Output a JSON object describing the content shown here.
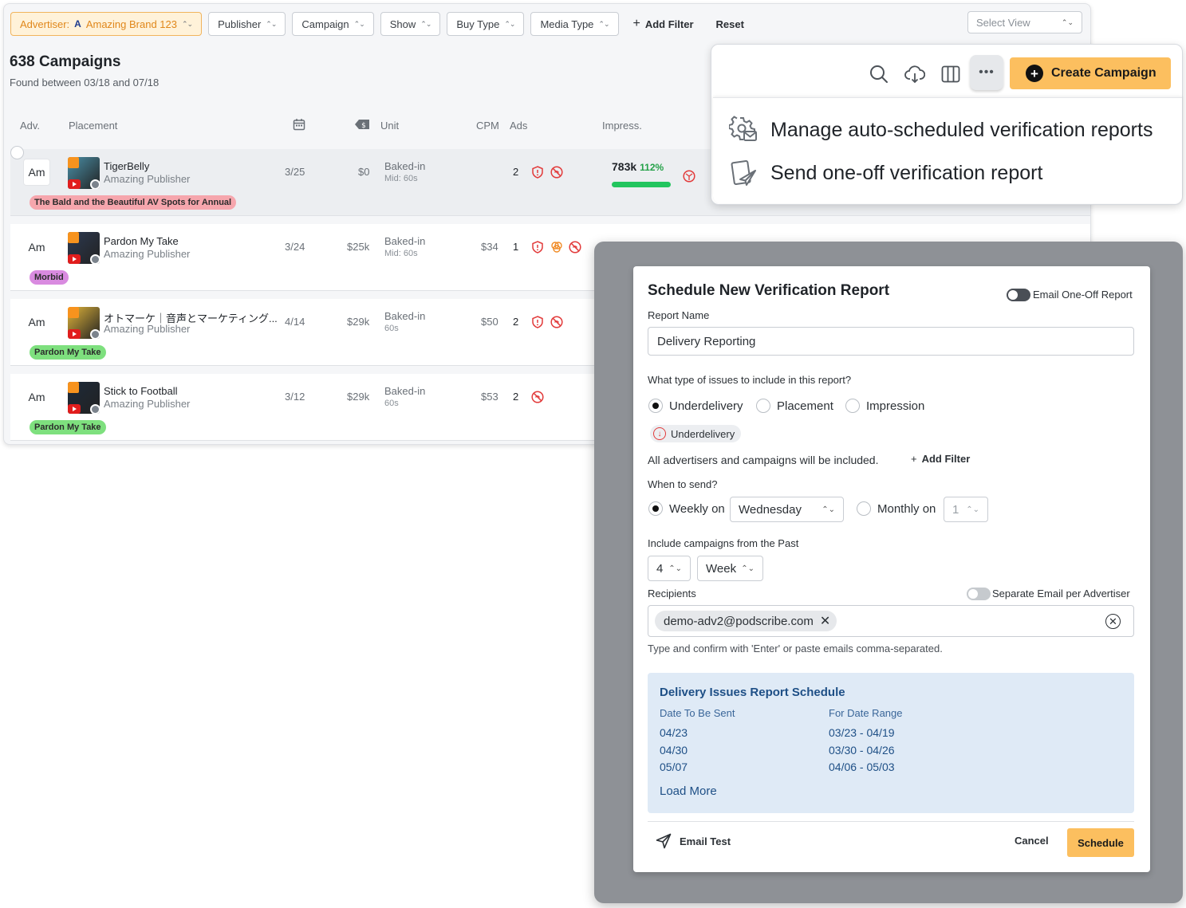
{
  "filters": {
    "advertiser_label": "Advertiser:",
    "advertiser_mark": "A",
    "advertiser_value": "Amazing Brand 123",
    "publisher": "Publisher",
    "campaign": "Campaign",
    "show": "Show",
    "buy_type": "Buy Type",
    "media_type": "Media Type",
    "add_filter": "Add Filter",
    "reset": "Reset",
    "select_view_placeholder": "Select View"
  },
  "summary": {
    "title": "638 Campaigns",
    "subtitle": "Found between 03/18 and 07/18"
  },
  "table": {
    "headers": {
      "adv": "Adv.",
      "placement": "Placement",
      "unit": "Unit",
      "cpm": "CPM",
      "ads": "Ads",
      "impress": "Impress."
    },
    "rows": [
      {
        "adv": "Am",
        "name": "TigerBelly",
        "publisher": "Amazing Publisher",
        "date": "3/25",
        "price": "$0",
        "unit": "Baked-in",
        "unit_detail": "Mid: 60s",
        "cpm": "",
        "ads": "2",
        "tag": "The Bald and the Beautiful AV Spots for Annual",
        "tag_color": "#f6a6ad",
        "impressions": "783k",
        "impressions_pct": "112%",
        "delivery_progress": 1.0,
        "art_color": "#4a90a8"
      },
      {
        "adv": "Am",
        "name": "Pardon My Take",
        "publisher": "Amazing Publisher",
        "date": "3/24",
        "price": "$25k",
        "unit": "Baked-in",
        "unit_detail": "Mid: 60s",
        "cpm": "$34",
        "ads": "1",
        "tag": "Morbid",
        "tag_color": "#d98be0",
        "art_color": "#2d3a52"
      },
      {
        "adv": "Am",
        "name": "オトマーケ｜音声とマーケティング...",
        "publisher": "Amazing Publisher",
        "date": "4/14",
        "price": "$29k",
        "unit": "Baked-in",
        "unit_detail": "60s",
        "cpm": "$50",
        "ads": "2",
        "tag": "Pardon My Take",
        "tag_color": "#7ee07e",
        "art_color": "#e0b43a"
      },
      {
        "adv": "Am",
        "name": "Stick to Football",
        "publisher": "Amazing Publisher",
        "date": "3/12",
        "price": "$29k",
        "unit": "Baked-in",
        "unit_detail": "60s",
        "cpm": "$53",
        "ads": "2",
        "tag": "Pardon My Take",
        "tag_color": "#7ee07e",
        "art_color": "#1d2a3a"
      }
    ]
  },
  "toolbar": {
    "icons": [
      "search-icon",
      "download-cloud-icon",
      "columns-icon",
      "more-icon"
    ],
    "create_campaign": "Create Campaign"
  },
  "more_menu": {
    "items": [
      "Manage auto-scheduled verification reports",
      "Send one-off verification report"
    ]
  },
  "modal": {
    "title": "Schedule New Verification Report",
    "email_one_off_label": "Email One-Off Report",
    "report_name_label": "Report Name",
    "report_name_value": "Delivery Reporting",
    "issues_question": "What type of issues to include in this report?",
    "issue_options": [
      "Underdelivery",
      "Placement",
      "Impression"
    ],
    "selected_issue": "Underdelivery",
    "issue_chip": "Underdelivery",
    "all_included_text": "All advertisers and campaigns will be included.",
    "add_filter": "Add Filter",
    "when_label": "When to send?",
    "weekly_label": "Weekly on",
    "weekly_value": "Wednesday",
    "monthly_label": "Monthly on",
    "monthly_value": "1",
    "past_label": "Include campaigns from the Past",
    "past_count": "4",
    "past_unit": "Week",
    "recipients_label": "Recipients",
    "separate_email_label": "Separate Email per Advertiser",
    "recipient": "demo-adv2@podscribe.com",
    "helper_text": "Type and confirm with 'Enter' or paste emails comma-separated.",
    "schedule": {
      "title": "Delivery Issues Report Schedule",
      "col_date": "Date To Be Sent",
      "col_range": "For Date Range",
      "rows": [
        {
          "date": "04/23",
          "range": "03/23 - 04/19"
        },
        {
          "date": "04/30",
          "range": "03/30 - 04/26"
        },
        {
          "date": "05/07",
          "range": "04/06 - 05/03"
        }
      ],
      "load_more": "Load More"
    },
    "email_test": "Email Test",
    "cancel": "Cancel",
    "submit": "Schedule"
  },
  "colors": {
    "accent": "#fcbf5f",
    "danger": "#e23b3b",
    "schedule_bg": "#dfeaf6",
    "schedule_text": "#1e4f86"
  }
}
